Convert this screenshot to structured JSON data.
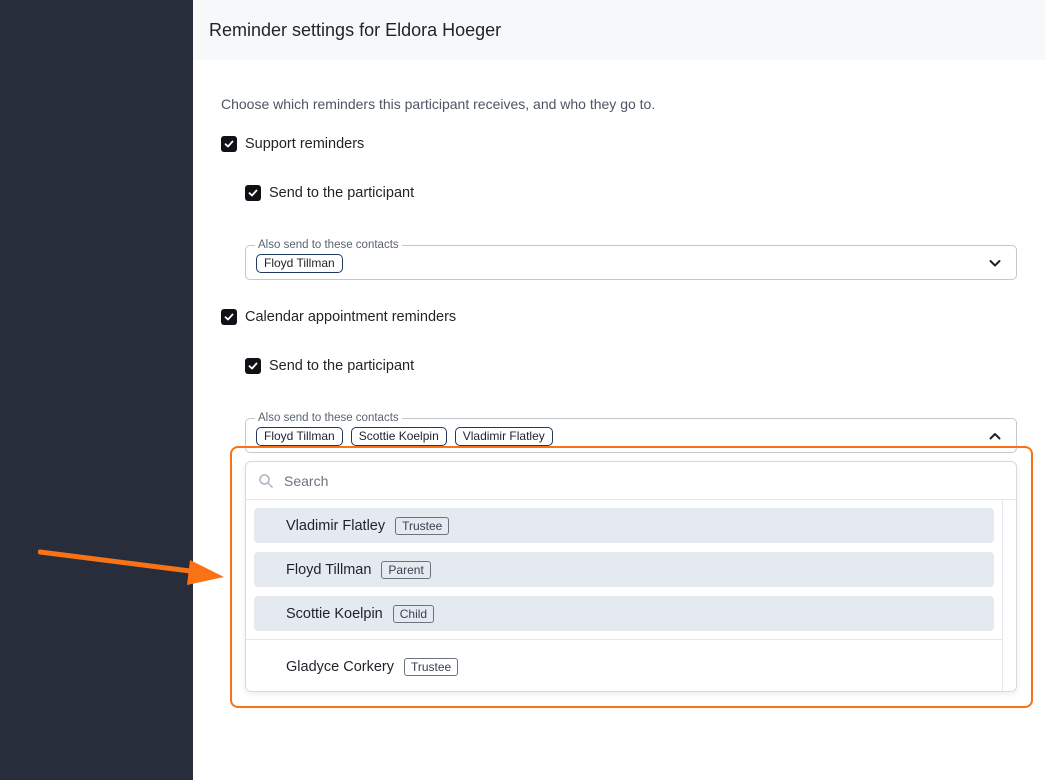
{
  "header": {
    "title": "Reminder settings for Eldora Hoeger"
  },
  "description": "Choose which reminders this participant receives, and who they go to.",
  "support": {
    "label": "Support reminders",
    "send_to_participant": "Send to the participant",
    "contacts_legend": "Also send to these contacts",
    "contacts": [
      "Floyd Tillman"
    ]
  },
  "calendar": {
    "label": "Calendar appointment reminders",
    "send_to_participant": "Send to the participant",
    "contacts_legend": "Also send to these contacts",
    "contacts": [
      "Floyd Tillman",
      "Scottie Koelpin",
      "Vladimir Flatley"
    ]
  },
  "dropdown": {
    "search_placeholder": "Search",
    "options": [
      {
        "name": "Vladimir Flatley",
        "role": "Trustee",
        "selected": true
      },
      {
        "name": "Floyd Tillman",
        "role": "Parent",
        "selected": true
      },
      {
        "name": "Scottie Koelpin",
        "role": "Child",
        "selected": true
      },
      {
        "name": "Gladyce Corkery",
        "role": "Trustee",
        "selected": false
      }
    ]
  },
  "colors": {
    "sidebar": "#272d3b",
    "highlight": "#f97316",
    "selected_option": "#e5eaf1",
    "checkbox": "#0f1117"
  }
}
